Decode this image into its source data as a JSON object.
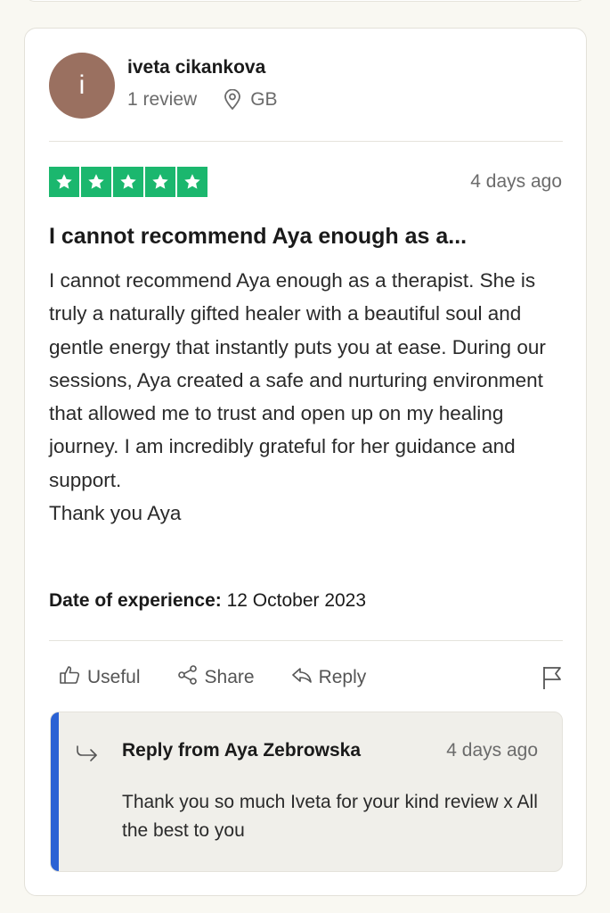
{
  "reviewer": {
    "avatar_letter": "i",
    "name": "iveta cikankova",
    "review_count": "1 review",
    "country": "GB"
  },
  "review": {
    "rating": 5,
    "date": "4 days ago",
    "title": "I cannot recommend Aya enough as a...",
    "body": [
      "I cannot recommend Aya enough as a therapist. She is truly a naturally gifted healer with a beautiful soul and gentle energy that instantly puts you at ease. During our sessions, Aya created a safe and nurturing environment that allowed me to trust and open up on my healing journey. I am incredibly grateful for her guidance and support.",
      "Thank you Aya"
    ],
    "experience_label": "Date of experience:",
    "experience_date": "12 October 2023"
  },
  "actions": {
    "useful": "Useful",
    "share": "Share",
    "reply": "Reply"
  },
  "reply": {
    "from": "Reply from Aya Zebrowska",
    "date": "4 days ago",
    "text": "Thank you so much Iveta for your kind review x All the best to you"
  },
  "colors": {
    "star_green": "#1bb76e",
    "avatar_brown": "#9a7060",
    "reply_accent_blue": "#2b62d4"
  }
}
